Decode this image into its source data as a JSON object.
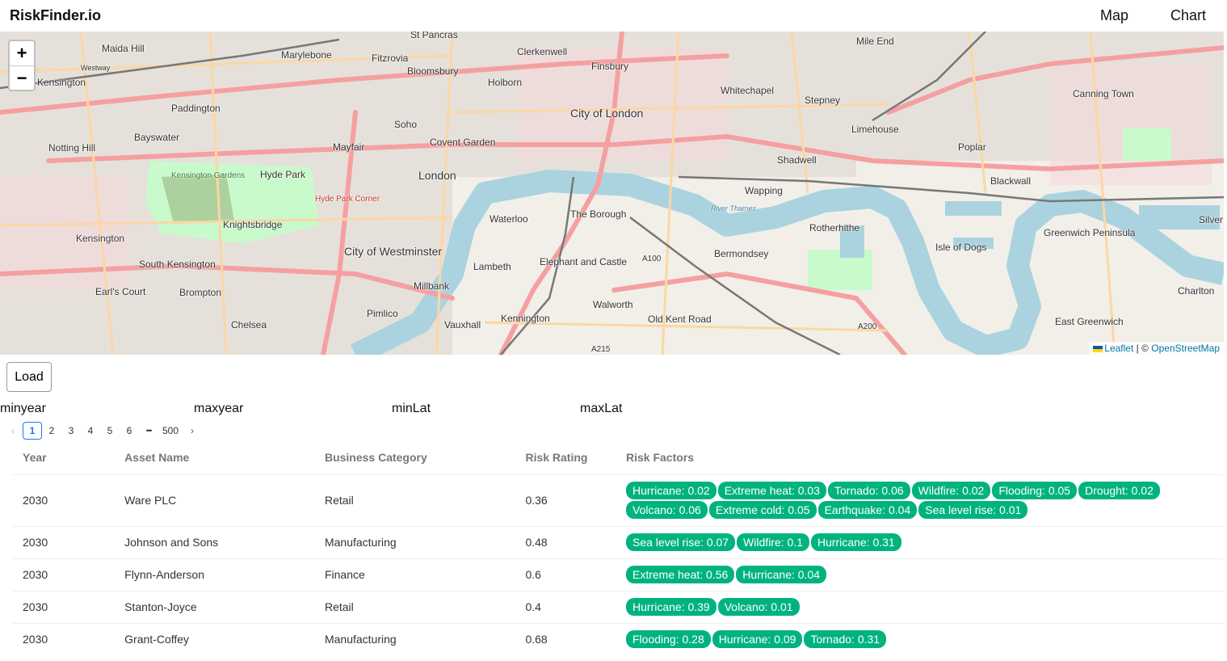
{
  "header": {
    "brand": "RiskFinder.io",
    "nav": [
      "Map",
      "Chart"
    ]
  },
  "map": {
    "zoom_in": "+",
    "zoom_out": "−",
    "attribution_leaflet": "Leaflet",
    "attribution_sep": "| ©",
    "attribution_osm": "OpenStreetMap",
    "labels": [
      "St Pancras",
      "Maida Hill",
      "Marylebone",
      "Fitzrovia",
      "Clerkenwell",
      "Finsbury",
      "Mile End",
      "Kensington",
      "Bloomsbury",
      "Holborn",
      "Whitechapel",
      "Stepney",
      "Canning Town",
      "Paddington",
      "City of London",
      "Soho",
      "Bayswater",
      "Limehouse",
      "Notting Hill",
      "Mayfair",
      "Covent Garden",
      "Poplar",
      "Shadwell",
      "Hyde Park",
      "London",
      "Wapping",
      "Blackwall",
      "Kensington Gardens",
      "Hyde Park Corner",
      "Knightsbridge",
      "Waterloo",
      "The Borough",
      "Rotherhithe",
      "Kensington",
      "Greenwich Peninsula",
      "Silver",
      "Isle of Dogs",
      "City of Westminster",
      "Bermondsey",
      "South Kensington",
      "Lambeth",
      "Elephant and Castle",
      "A100",
      "Earl's Court",
      "Brompton",
      "Millbank",
      "Charlton",
      "Walworth",
      "Pimlico",
      "Kennington",
      "Old Kent Road",
      "Chelsea",
      "Vauxhall",
      "A200",
      "East Greenwich",
      "A215",
      "Westway",
      "River Thames"
    ]
  },
  "controls": {
    "load_label": "Load",
    "filters": [
      "minyear",
      "maxyear",
      "minLat",
      "maxLat"
    ]
  },
  "pagination": {
    "prev": "‹",
    "pages": [
      "1",
      "2",
      "3",
      "4",
      "5",
      "6"
    ],
    "ellipsis": "•••",
    "last": "500",
    "next": "›",
    "current": "1"
  },
  "table": {
    "columns": [
      "Year",
      "Asset Name",
      "Business Category",
      "Risk Rating",
      "Risk Factors"
    ],
    "rows": [
      {
        "year": "2030",
        "name": "Ware PLC",
        "category": "Retail",
        "rating": "0.36",
        "factors": [
          "Hurricane: 0.02",
          "Extreme heat: 0.03",
          "Tornado: 0.06",
          "Wildfire: 0.02",
          "Flooding: 0.05",
          "Drought: 0.02",
          "Volcano: 0.06",
          "Extreme cold: 0.05",
          "Earthquake: 0.04",
          "Sea level rise: 0.01"
        ]
      },
      {
        "year": "2030",
        "name": "Johnson and Sons",
        "category": "Manufacturing",
        "rating": "0.48",
        "factors": [
          "Sea level rise: 0.07",
          "Wildfire: 0.1",
          "Hurricane: 0.31"
        ]
      },
      {
        "year": "2030",
        "name": "Flynn-Anderson",
        "category": "Finance",
        "rating": "0.6",
        "factors": [
          "Extreme heat: 0.56",
          "Hurricane: 0.04"
        ]
      },
      {
        "year": "2030",
        "name": "Stanton-Joyce",
        "category": "Retail",
        "rating": "0.4",
        "factors": [
          "Hurricane: 0.39",
          "Volcano: 0.01"
        ]
      },
      {
        "year": "2030",
        "name": "Grant-Coffey",
        "category": "Manufacturing",
        "rating": "0.68",
        "factors": [
          "Flooding: 0.28",
          "Hurricane: 0.09",
          "Tornado: 0.31"
        ]
      }
    ]
  },
  "colors": {
    "tag": "#00b37e",
    "water": "#aad3df",
    "park": "#c8facc",
    "road_major": "#f5a0a0",
    "road_secondary": "#fcd6a4"
  }
}
